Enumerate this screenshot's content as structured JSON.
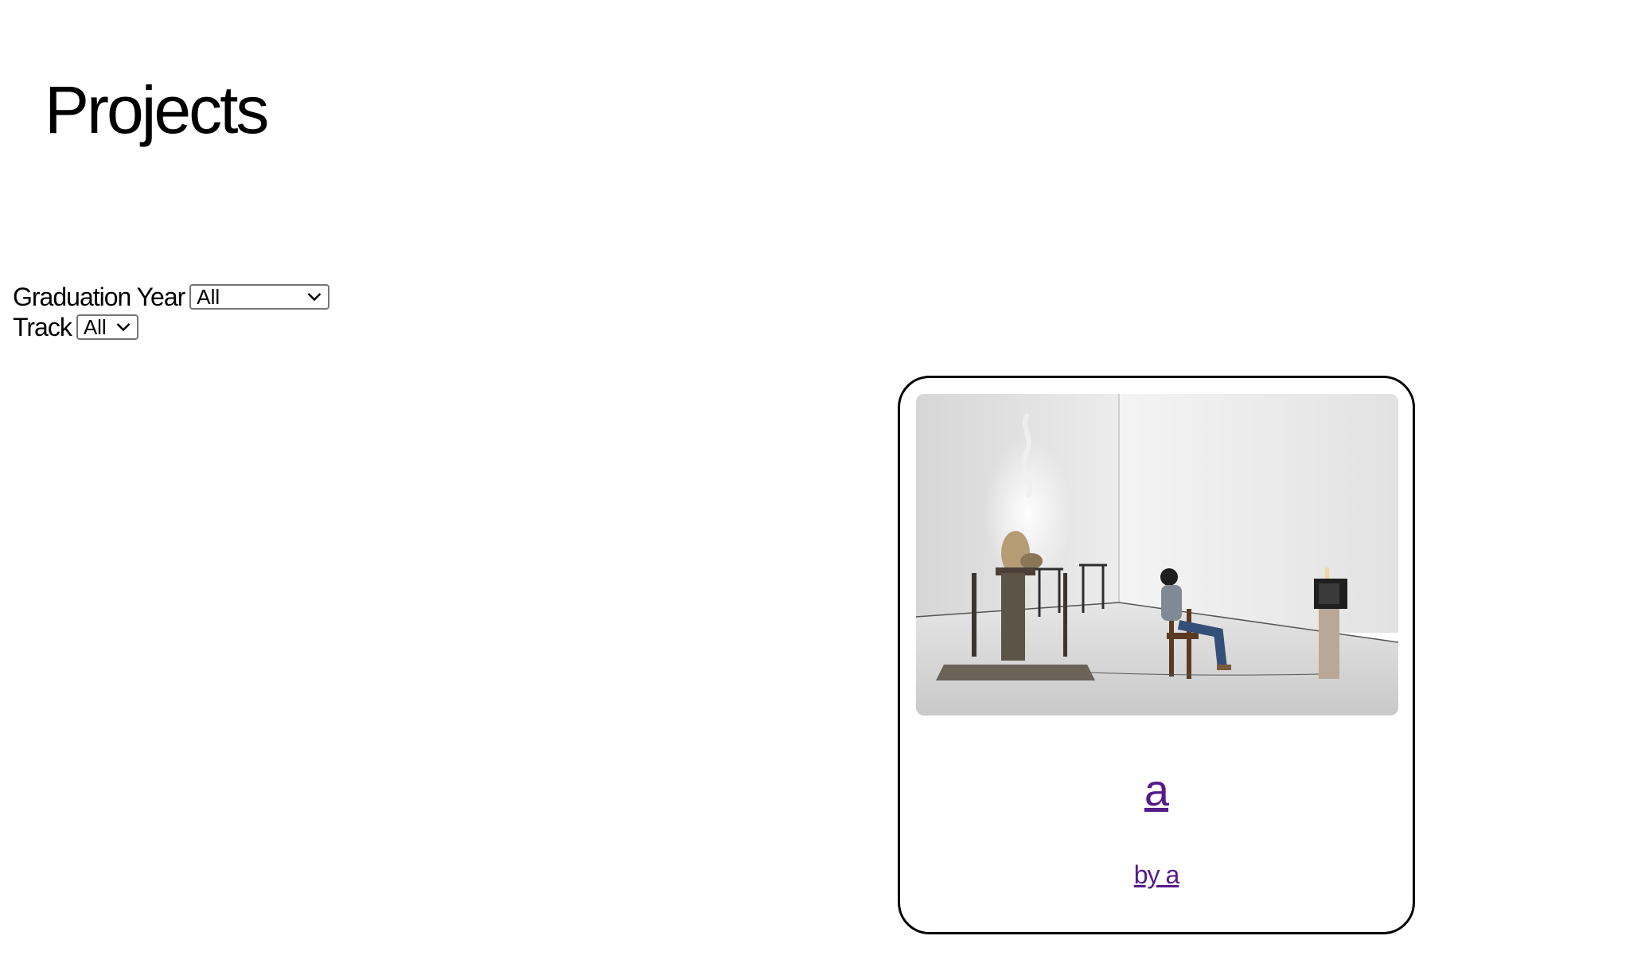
{
  "header": {
    "title": "Projects"
  },
  "filters": {
    "graduation_year": {
      "label": "Graduation Year",
      "selected": "All"
    },
    "track": {
      "label": "Track",
      "selected": "All"
    }
  },
  "projects": [
    {
      "title": "a",
      "author": "by a",
      "image_icon": "installation-photo"
    }
  ],
  "colors": {
    "link_visited": "#551a8b",
    "card_border": "#000000",
    "select_border": "#767676"
  }
}
